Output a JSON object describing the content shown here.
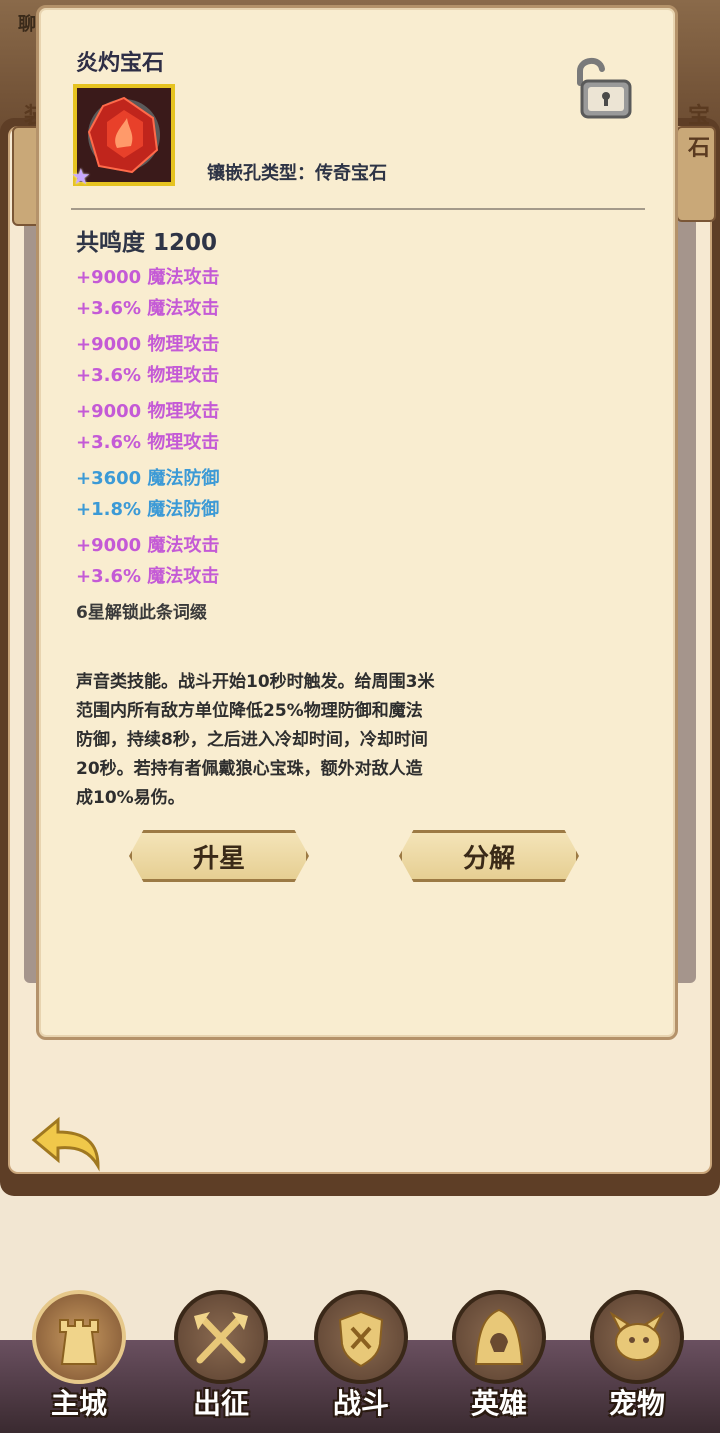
{
  "header": {
    "chat_label": "聊",
    "left_tab_label": "装",
    "right_tab_label": "宝石"
  },
  "popup": {
    "title": "炎灼宝石",
    "socket_type": "镶嵌孔类型：传奇宝石",
    "resonance": "共鸣度 1200",
    "attribute_groups": [
      {
        "color": "purple",
        "lines": [
          "+9000 魔法攻击",
          "+3.6% 魔法攻击"
        ]
      },
      {
        "color": "purple",
        "lines": [
          "+9000 物理攻击",
          "+3.6% 物理攻击"
        ]
      },
      {
        "color": "purple",
        "lines": [
          "+9000 物理攻击",
          "+3.6% 物理攻击"
        ]
      },
      {
        "color": "blue",
        "lines": [
          "+3600 魔法防御",
          "+1.8% 魔法防御"
        ]
      },
      {
        "color": "purple",
        "lines": [
          "+9000 魔法攻击",
          "+3.6% 魔法攻击"
        ]
      }
    ],
    "unlock_note": "6星解锁此条词缀",
    "description_lines": [
      "声音类技能。战斗开始10秒时触发。给周围3米",
      "范围内所有敌方单位降低25%物理防御和魔法",
      "防御，持续8秒，之后进入冷却时间，冷却时间",
      "20秒。若持有者佩戴狼心宝珠，额外对敌人造",
      "成10%易伤。"
    ],
    "buttons": {
      "star_up": "升星",
      "disassemble": "分解"
    }
  },
  "nav": {
    "items": [
      {
        "label": "主城",
        "icon": "castle-icon"
      },
      {
        "label": "出征",
        "icon": "crossed-axes-icon"
      },
      {
        "label": "战斗",
        "icon": "shield-swords-icon"
      },
      {
        "label": "英雄",
        "icon": "hooded-hero-icon"
      },
      {
        "label": "宠物",
        "icon": "dragon-pet-icon"
      }
    ],
    "active_index": 0
  },
  "colors": {
    "purple": "#c45ad6",
    "blue": "#3c9ad6",
    "gem_frame": "#e6c320"
  }
}
